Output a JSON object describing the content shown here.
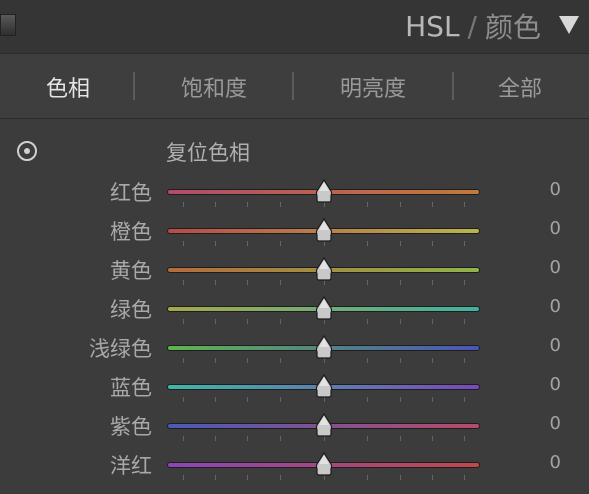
{
  "header": {
    "title_en": "HSL",
    "separator": "/",
    "title_cn": "颜色"
  },
  "tabs": [
    {
      "label": "色相",
      "active": true
    },
    {
      "label": "饱和度",
      "active": false
    },
    {
      "label": "明亮度",
      "active": false
    },
    {
      "label": "全部",
      "active": false
    }
  ],
  "panel": {
    "reset_label": "复位色相"
  },
  "sliders": [
    {
      "label": "红色",
      "value": "0",
      "gradient": [
        "#b34b6a",
        "#c07a3a"
      ]
    },
    {
      "label": "橙色",
      "value": "0",
      "gradient": [
        "#b94a4a",
        "#b8b64a"
      ]
    },
    {
      "label": "黄色",
      "value": "0",
      "gradient": [
        "#b56b3c",
        "#8fb44a"
      ]
    },
    {
      "label": "绿色",
      "value": "0",
      "gradient": [
        "#a6a84a",
        "#3fb2a0"
      ]
    },
    {
      "label": "浅绿色",
      "value": "0",
      "gradient": [
        "#5eb54e",
        "#4a55b6"
      ]
    },
    {
      "label": "蓝色",
      "value": "0",
      "gradient": [
        "#3fb7a7",
        "#7a48b8"
      ]
    },
    {
      "label": "紫色",
      "value": "0",
      "gradient": [
        "#4a5ab8",
        "#b94a6a"
      ]
    },
    {
      "label": "洋红",
      "value": "0",
      "gradient": [
        "#8a46b8",
        "#c0484a"
      ]
    }
  ]
}
